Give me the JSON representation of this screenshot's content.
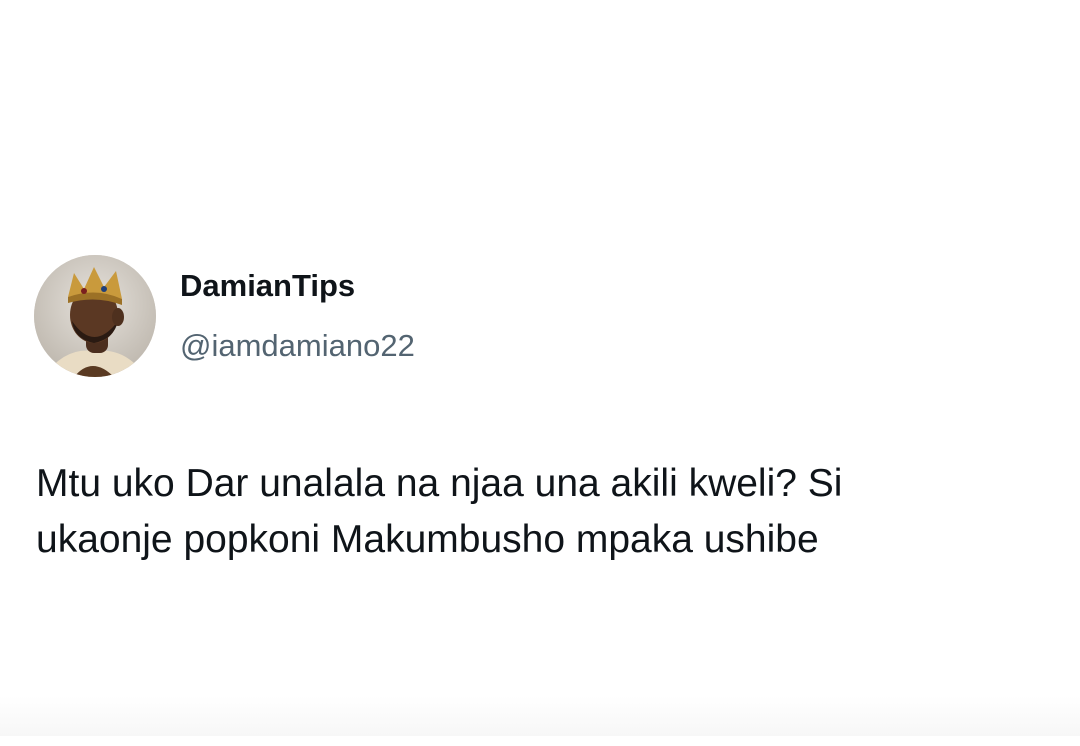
{
  "tweet": {
    "author": {
      "display_name": "DamianTips",
      "handle": "@iamdamiano22",
      "avatar_icon": "avatar-photo"
    },
    "text_lines": [
      "Mtu uko Dar unalala na njaa una akili kweli? Si",
      "ukaonje popkoni Makumbusho mpaka ushibe"
    ]
  },
  "colors": {
    "top_bar": "#5b5b5b",
    "name_text": "#0f1419",
    "handle_text": "#536471",
    "background": "#ffffff"
  }
}
